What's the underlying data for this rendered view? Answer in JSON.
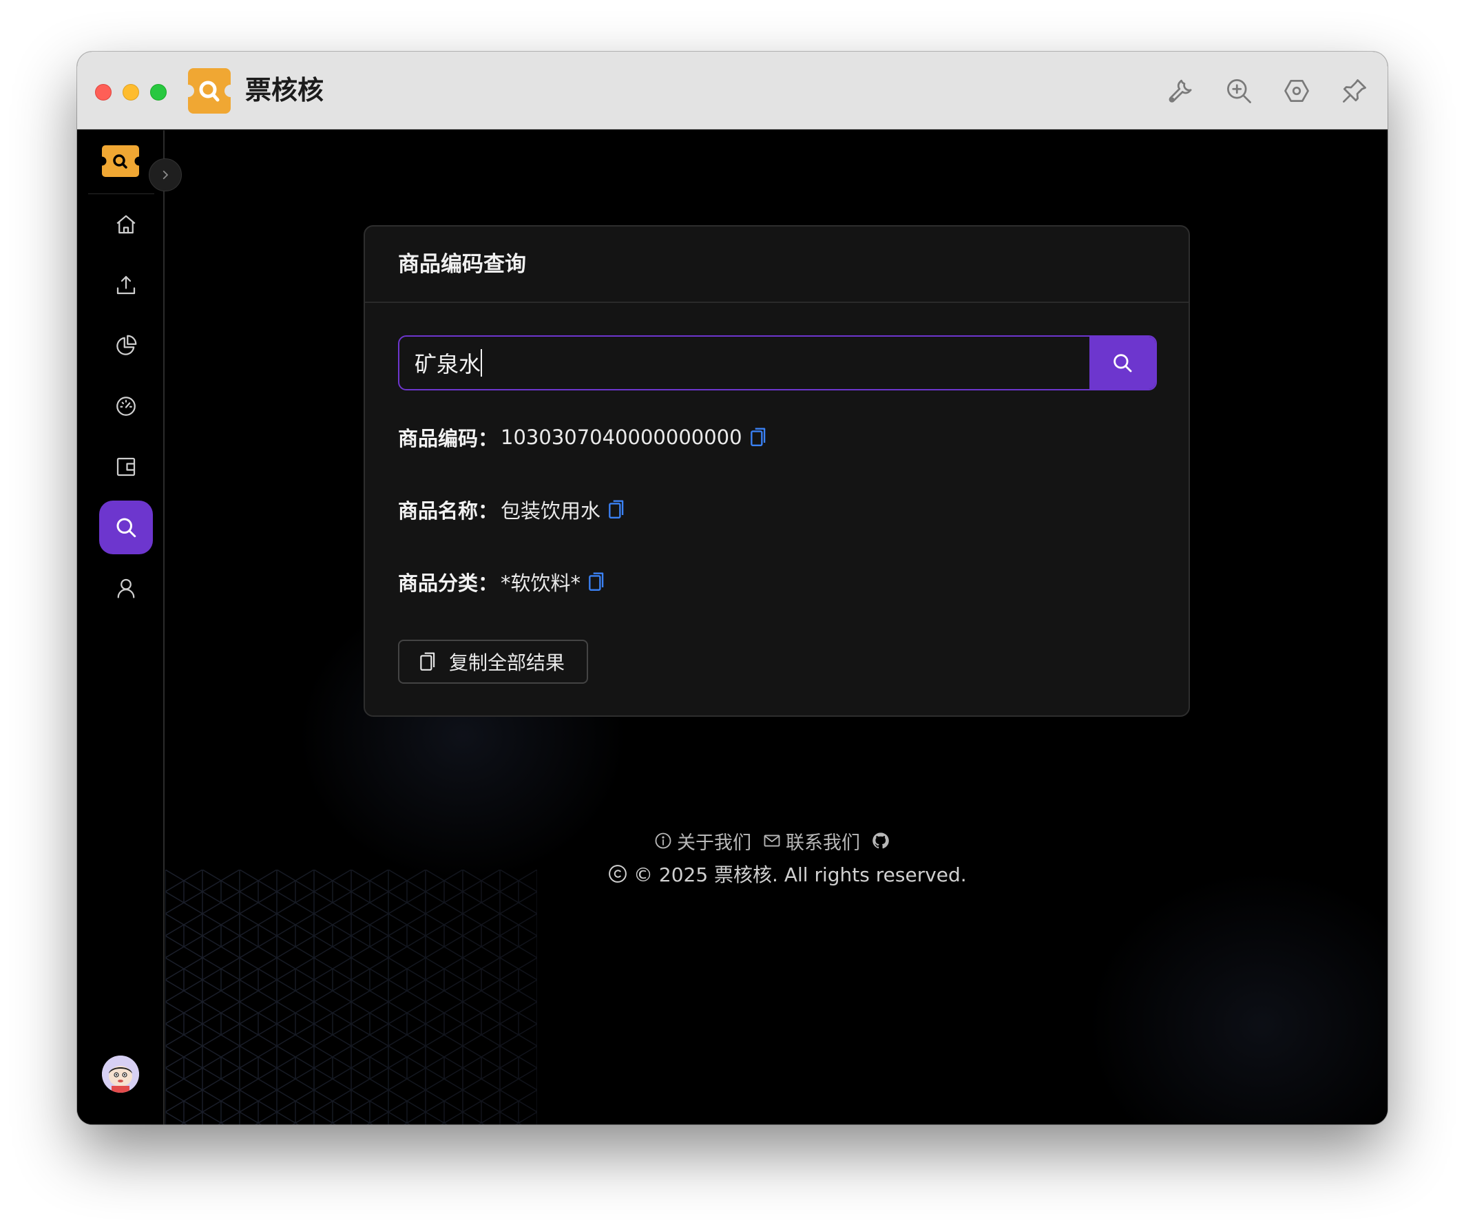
{
  "app": {
    "title": "票核核"
  },
  "titlebar": {
    "icons": [
      "wrench-icon",
      "zoom-in-icon",
      "settings-icon",
      "pin-icon"
    ]
  },
  "sidebar": {
    "items": [
      {
        "icon": "home-icon",
        "active": false
      },
      {
        "icon": "upload-icon",
        "active": false
      },
      {
        "icon": "pie-chart-icon",
        "active": false
      },
      {
        "icon": "dashboard-icon",
        "active": false
      },
      {
        "icon": "wallet-icon",
        "active": false
      },
      {
        "icon": "search-icon",
        "active": true
      },
      {
        "icon": "user-icon",
        "active": false
      }
    ]
  },
  "card": {
    "title": "商品编码查询",
    "search": {
      "value": "矿泉水",
      "placeholder": ""
    },
    "results": [
      {
        "label": "商品编码：",
        "value": "1030307040000000000"
      },
      {
        "label": "商品名称：",
        "value": "包装饮用水"
      },
      {
        "label": "商品分类：",
        "value": "*软饮料*"
      }
    ],
    "copy_all_label": "复制全部结果"
  },
  "footer": {
    "about": "关于我们",
    "contact": "联系我们",
    "copyright": "© 2025 票核核. All rights reserved."
  },
  "colors": {
    "accent": "#6d36ce",
    "copy_icon": "#3b82f6",
    "titlebar_bg": "#e3e3e3",
    "content_bg": "#000000",
    "card_bg": "#141414"
  }
}
